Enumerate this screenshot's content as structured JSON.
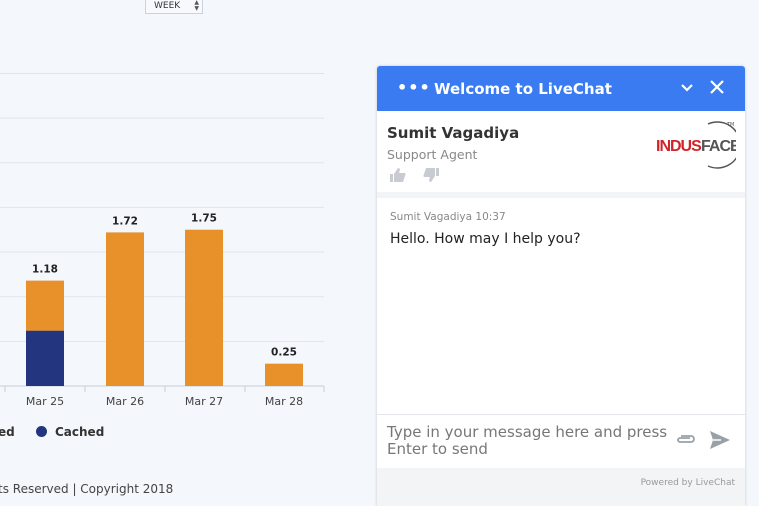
{
  "week_select": {
    "value": "WEEK"
  },
  "chart_data": {
    "type": "bar",
    "stacked": true,
    "categories": [
      "Mar 25",
      "Mar 26",
      "Mar 27",
      "Mar 28"
    ],
    "series": [
      {
        "name": "Cached",
        "values": [
          0.62,
          0,
          0,
          0
        ],
        "color": "#24357f"
      },
      {
        "name": "",
        "values": [
          0.56,
          1.72,
          1.75,
          0.25
        ],
        "color": "#e8902a"
      }
    ],
    "totals": [
      "1.18",
      "1.72",
      "1.75",
      "0.25"
    ],
    "ylim": [
      0,
      3.5
    ],
    "grid": true
  },
  "legend": {
    "partial_label": "ed",
    "cached_label": "Cached"
  },
  "footer": {
    "text": "ts Reserved | Copyright 2018"
  },
  "chat": {
    "title": "Welcome to LiveChat",
    "agent_name": "Sumit Vagadiya",
    "agent_role": "Support Agent",
    "logo_text": "INDUSFACE",
    "message_meta": "Sumit Vagadiya 10:37",
    "message_text": "Hello. How may I help you?",
    "input_placeholder": "Type in your message here and press Enter to send",
    "powered_by": "Powered by LiveChat",
    "colors": {
      "header": "#3a7bf1"
    }
  }
}
